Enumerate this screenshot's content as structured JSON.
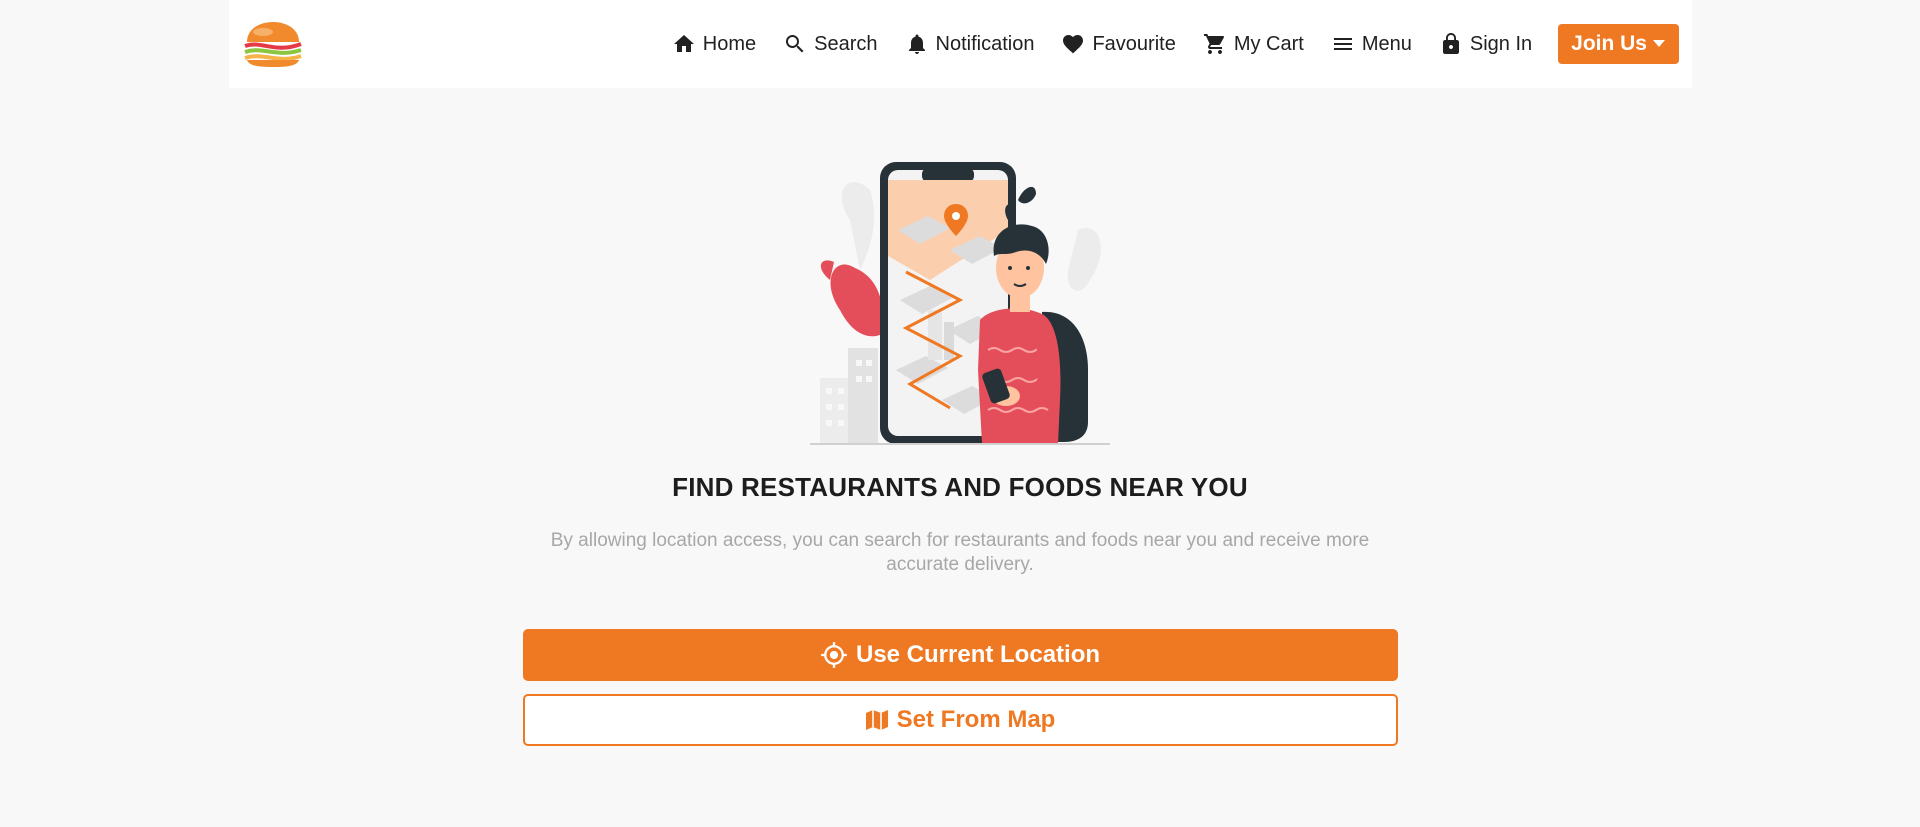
{
  "app": {
    "logo_name": "burger-logo"
  },
  "nav": {
    "items": [
      {
        "label": "Home",
        "icon": "home-icon"
      },
      {
        "label": "Search",
        "icon": "search-icon"
      },
      {
        "label": "Notification",
        "icon": "bell-icon"
      },
      {
        "label": "Favourite",
        "icon": "heart-icon"
      },
      {
        "label": "My Cart",
        "icon": "cart-icon"
      },
      {
        "label": "Menu",
        "icon": "menu-icon"
      },
      {
        "label": "Sign In",
        "icon": "lock-icon"
      }
    ],
    "join_label": "Join Us"
  },
  "hero": {
    "title": "FIND RESTAURANTS AND FOODS NEAR YOU",
    "description": "By allowing location access, you can search for restaurants and foods near you and receive more accurate delivery.",
    "use_location_label": "Use Current Location",
    "set_from_map_label": "Set From Map"
  },
  "colors": {
    "accent": "#ef7822",
    "background": "#f8f8f8",
    "navbar": "#ffffff",
    "muted_text": "#a7a7a7"
  }
}
